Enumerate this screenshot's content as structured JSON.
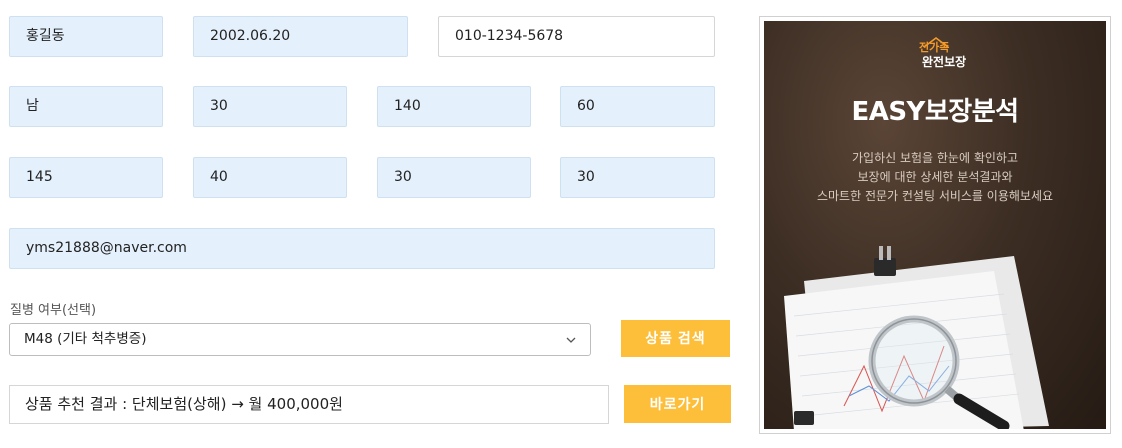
{
  "form": {
    "name": "홍길동",
    "birth": "2002.06.20",
    "phone": "010-1234-5678",
    "gender": "남",
    "age": "30",
    "height": "140",
    "weight": "60",
    "row3_a": "145",
    "row3_b": "40",
    "row3_c": "30",
    "row3_d": "30",
    "email": "yms21888@naver.com"
  },
  "disease": {
    "label": "질병 여부(선택)",
    "selected": "M48 (기타 척추병증)"
  },
  "buttons": {
    "search": "상품 검색",
    "go": "바로가기"
  },
  "result": {
    "text": "상품 추천 결과 : 단체보험(상해) → 월 400,000원"
  },
  "promo": {
    "logo_top": "전가족",
    "logo_bottom": "완전보장",
    "title": "EASY보장분석",
    "desc": [
      "가입하신 보험을 한눈에 확인하고",
      "보장에 대한 상세한 분석결과와",
      "스마트한 전문가 컨설팅 서비스를 이용해보세요"
    ]
  },
  "colors": {
    "field_bg": "#e4f0fc",
    "button": "#fdbe3a",
    "promo_bg": "#3d2e24",
    "logo_orange": "#f39a2a"
  }
}
